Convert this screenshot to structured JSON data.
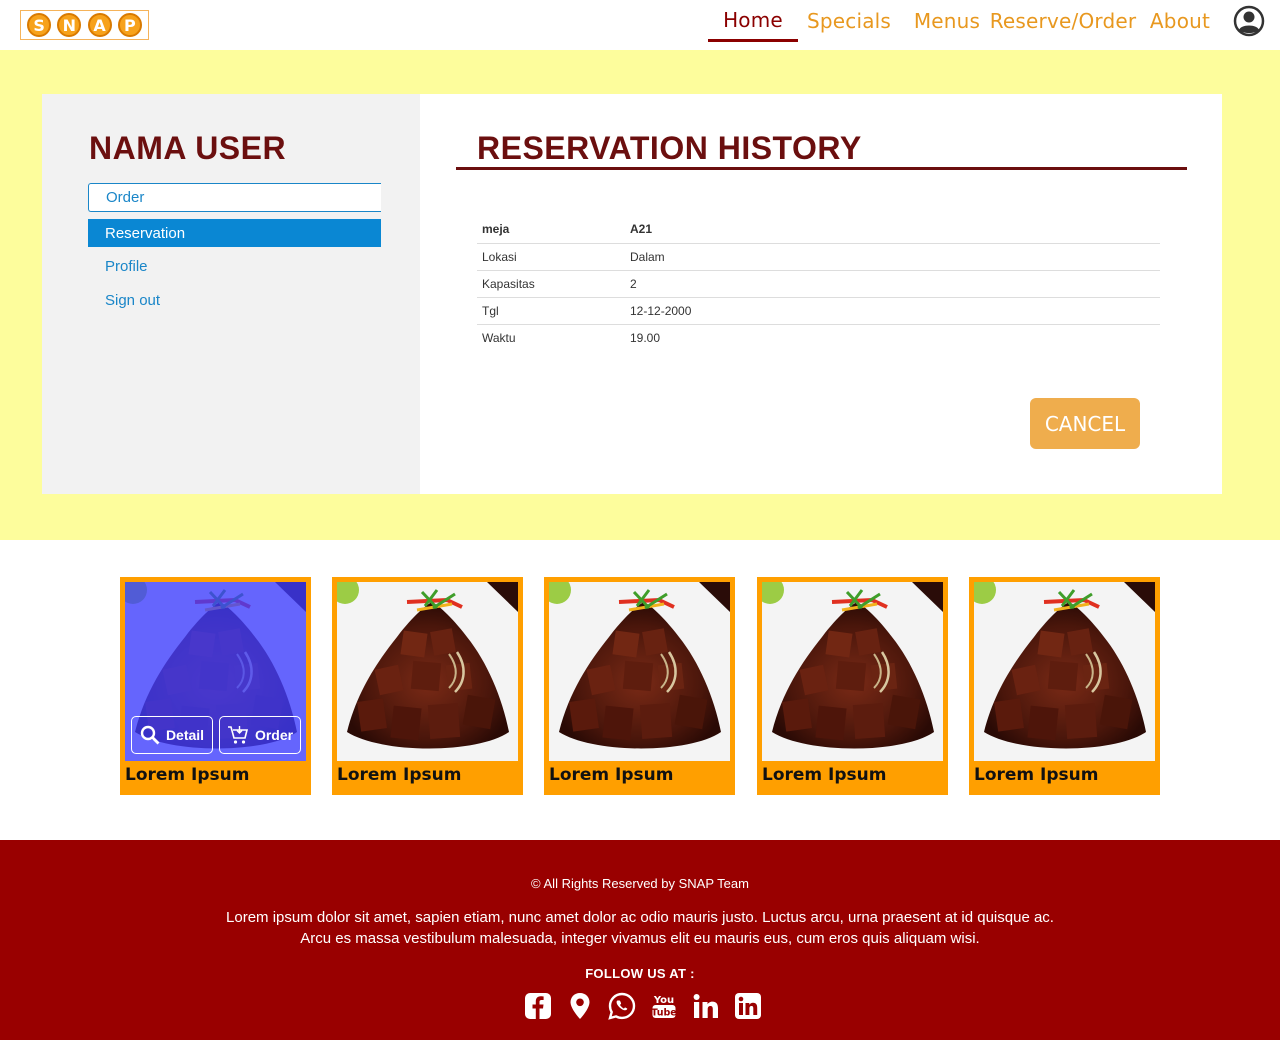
{
  "header": {
    "logo_letters": [
      "S",
      "N",
      "A",
      "P"
    ],
    "nav": [
      {
        "label": "Home",
        "active": true
      },
      {
        "label": "Specials",
        "active": false
      },
      {
        "label": "Menus",
        "active": false
      },
      {
        "label": "Reserve/Order",
        "active": false
      },
      {
        "label": "About",
        "active": false
      }
    ],
    "user_icon": "user-circle-icon"
  },
  "sidebar": {
    "user_name": "NAMA USER",
    "items": [
      {
        "label": "Order",
        "state": "outlined"
      },
      {
        "label": "Reservation",
        "state": "selected"
      },
      {
        "label": "Profile",
        "state": "normal"
      },
      {
        "label": "Sign out",
        "state": "normal"
      }
    ]
  },
  "reservation": {
    "title": "RESERVATION HISTORY",
    "rows": [
      {
        "key": "meja",
        "value": "A21"
      },
      {
        "key": "Lokasi",
        "value": "Dalam"
      },
      {
        "key": "Kapasitas",
        "value": "2"
      },
      {
        "key": "Tgl",
        "value": "12-12-2000"
      },
      {
        "key": "Waktu",
        "value": "19.00"
      }
    ],
    "cancel_label": "CANCEL"
  },
  "cards": [
    {
      "name": "Lorem Ipsum",
      "hover": true,
      "detail_label": "Detail",
      "order_label": "Order"
    },
    {
      "name": "Lorem Ipsum",
      "hover": false
    },
    {
      "name": "Lorem Ipsum",
      "hover": false
    },
    {
      "name": "Lorem Ipsum",
      "hover": false
    },
    {
      "name": "Lorem Ipsum",
      "hover": false
    }
  ],
  "footer": {
    "copyright": "© All Rights Reserved by SNAP Team",
    "lorem_line1": "Lorem ipsum dolor sit amet, sapien etiam, nunc amet dolor ac odio mauris justo. Luctus arcu, urna praesent at id quisque ac.",
    "lorem_line2": "Arcu es massa vestibulum malesuada, integer vivamus elit eu mauris eus, cum eros quis aliquam wisi.",
    "follow_label": "FOLLOW US AT :",
    "socials": [
      "facebook-icon",
      "map-pin-icon",
      "whatsapp-icon",
      "youtube-icon",
      "linkedin-icon",
      "linkedin-box-icon"
    ]
  },
  "colors": {
    "brand_dark_red": "#990000",
    "heading_red": "#6b0f0f",
    "accent_orange": "#ff9f00",
    "nav_orange": "#e8981f",
    "link_blue": "#1a86c8",
    "band_yellow": "#fdfd9c",
    "cancel_orange": "#efad4d"
  }
}
